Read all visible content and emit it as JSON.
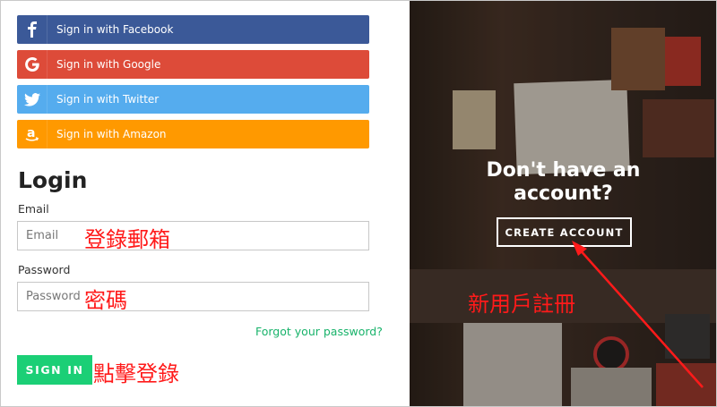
{
  "social_buttons": {
    "facebook": "Sign in with Facebook",
    "google": "Sign in with Google",
    "twitter": "Sign in with Twitter",
    "amazon": "Sign in with Amazon"
  },
  "login": {
    "title": "Login",
    "email_label": "Email",
    "email_placeholder": "Email",
    "password_label": "Password",
    "password_placeholder": "Password",
    "forgot": "Forgot your password?",
    "sign_in": "SIGN IN"
  },
  "signup": {
    "prompt_line1": "Don't have an",
    "prompt_line2": "account?",
    "create_account": "CREATE ACCOUNT"
  },
  "annotations": {
    "email": "登錄郵箱",
    "password": "密碼",
    "sign_in": "點擊登錄",
    "register": "新用戶註冊"
  },
  "colors": {
    "facebook": "#3b5998",
    "google": "#dd4b39",
    "twitter": "#55acee",
    "amazon": "#ff9900",
    "sign_in": "#1bcf76",
    "link": "#19b36b",
    "annotation": "#ff1a1a"
  }
}
